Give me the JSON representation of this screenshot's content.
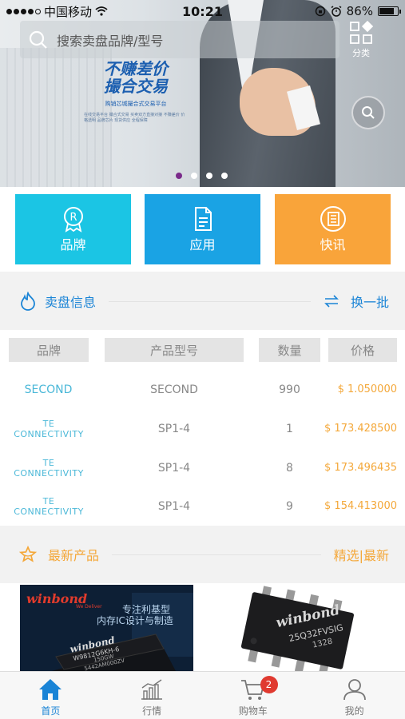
{
  "status_bar": {
    "carrier": "中国移动",
    "time": "10:21",
    "battery": "86%",
    "battery_level": 0.86
  },
  "search": {
    "placeholder": "搜索卖盘品牌/型号"
  },
  "header": {
    "category_label": "分类"
  },
  "banner": {
    "title_line1": "不赚差价",
    "title_line2": "撮合交易",
    "subtitle": "购销芯城撮合式交易平台",
    "description": "在线交易平台 撮合式交易 买卖双方直接对接 不赚差价 价格透明 品牌芯片 现货供应 全程保障",
    "slide_count": 4,
    "active_slide": 1
  },
  "tiles": [
    {
      "label": "品牌",
      "color": "#1bc5e4",
      "icon": "r-badge-icon"
    },
    {
      "label": "应用",
      "color": "#1aa3e4",
      "icon": "document-icon"
    },
    {
      "label": "快讯",
      "color": "#f9a43a",
      "icon": "news-icon"
    }
  ],
  "sale_section": {
    "title": "卖盘信息",
    "refresh_label": "换一批"
  },
  "table": {
    "headers": [
      "品牌",
      "产品型号",
      "数量",
      "价格"
    ],
    "rows": [
      {
        "brand": "SECOND",
        "model": "SECOND",
        "qty": "990",
        "price": "$ 1.050000"
      },
      {
        "brand": "TE CONNECTIVITY",
        "model": "SP1-4",
        "qty": "1",
        "price": "$ 173.428500"
      },
      {
        "brand": "TE CONNECTIVITY",
        "model": "SP1-4",
        "qty": "8",
        "price": "$ 173.496435"
      },
      {
        "brand": "TE CONNECTIVITY",
        "model": "SP1-4",
        "qty": "9",
        "price": "$ 154.413000"
      }
    ]
  },
  "new_products": {
    "title": "最新产品",
    "links_label": "精选|最新",
    "items": [
      {
        "brand": "winbond",
        "tagline": "We Deliver",
        "slogan_line1": "专注利基型",
        "slogan_line2": "内存IC设计与制造",
        "chip_brand": "winbond",
        "chip_code1": "W9812G6KH-6",
        "chip_code2": "150GW",
        "chip_code3": "5442AM000ZV"
      },
      {
        "chip_brand": "winbond",
        "chip_code1": "25Q32FVSIG",
        "chip_code2": "1328"
      }
    ]
  },
  "bottom_nav": [
    {
      "label": "首页",
      "icon": "home-icon",
      "active": true
    },
    {
      "label": "行情",
      "icon": "chart-icon",
      "active": false
    },
    {
      "label": "购物车",
      "icon": "cart-icon",
      "active": false,
      "badge": "2"
    },
    {
      "label": "我的",
      "icon": "user-icon",
      "active": false
    }
  ],
  "colors": {
    "accent_blue": "#1a84d6",
    "brand_text": "#4bb8d8",
    "price": "#f4a83a",
    "new_products_accent": "#f4a83a"
  }
}
